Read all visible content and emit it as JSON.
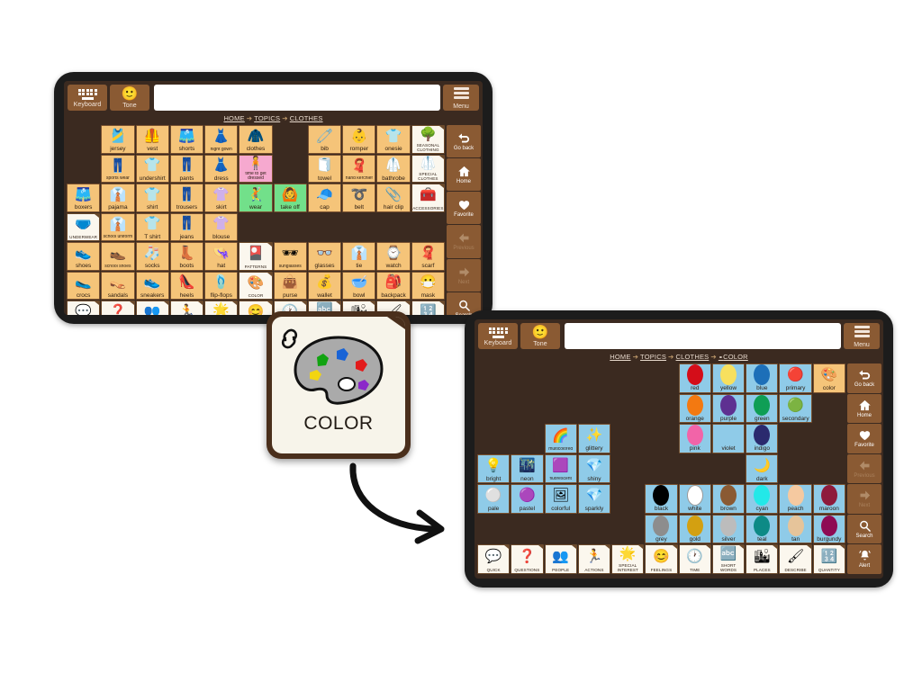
{
  "app": {
    "topbar": {
      "keyboard_label": "Keyboard",
      "tone_label": "Tone",
      "menu_label": "Menu",
      "message_value": "",
      "message_placeholder": ""
    },
    "rail": [
      {
        "name": "go-back",
        "label": "Go back",
        "icon": "go-back-icon",
        "dim": false
      },
      {
        "name": "home",
        "label": "Home",
        "icon": "home-icon",
        "dim": false
      },
      {
        "name": "favorite",
        "label": "Favorite",
        "icon": "heart-icon",
        "dim": false
      },
      {
        "name": "previous",
        "label": "Previous",
        "icon": "arrow-left-icon",
        "dim": true
      },
      {
        "name": "next",
        "label": "Next",
        "icon": "arrow-right-icon",
        "dim": true
      },
      {
        "name": "search",
        "label": "Search",
        "icon": "search-icon",
        "dim": false
      },
      {
        "name": "alert",
        "label": "Alert",
        "icon": "bell-icon",
        "dim": false
      }
    ],
    "colors": {
      "shell": "#1c1c1c",
      "screen_bg": "#3b2a20",
      "brown_button": "#8a5a33",
      "noun_tile": "#f5c479",
      "verb_tile": "#72e08a",
      "social_tile": "#f6a9cf",
      "color_tile": "#8fcbe8",
      "category_tile": "#fbf7ee",
      "grid_border": "#7a5230"
    }
  },
  "tablet1": {
    "breadcrumb": [
      "HOME",
      "TOPICS",
      "CLOTHES"
    ],
    "columns": 11,
    "rows": 8,
    "cells": [
      [
        {
          "label": "",
          "type": "empty"
        },
        {
          "label": "jersey",
          "type": "noun",
          "art": "jersey"
        },
        {
          "label": "vest",
          "type": "noun",
          "art": "vest"
        },
        {
          "label": "shorts",
          "type": "noun",
          "art": "shorts"
        },
        {
          "label": "night gown",
          "type": "noun",
          "art": "nightgown",
          "small": true
        },
        {
          "label": "clothes",
          "type": "noun",
          "art": "clothes"
        },
        {
          "label": "",
          "type": "empty"
        },
        {
          "label": "bib",
          "type": "noun",
          "art": "bib"
        },
        {
          "label": "romper",
          "type": "noun",
          "art": "romper"
        },
        {
          "label": "onesie",
          "type": "noun",
          "art": "onesie"
        },
        {
          "label": "SEASONAL CLOTHING",
          "type": "folder",
          "art": "seasonal"
        }
      ],
      [
        {
          "label": "",
          "type": "empty"
        },
        {
          "label": "sports wear",
          "type": "noun",
          "art": "sportswear",
          "small": true
        },
        {
          "label": "undershirt",
          "type": "noun",
          "art": "undershirt"
        },
        {
          "label": "pants",
          "type": "noun",
          "art": "pants"
        },
        {
          "label": "dress",
          "type": "noun",
          "art": "dress"
        },
        {
          "label": "time to get dressed",
          "type": "social",
          "art": "getdressed",
          "small": true
        },
        {
          "label": "",
          "type": "empty"
        },
        {
          "label": "towel",
          "type": "noun",
          "art": "towel"
        },
        {
          "label": "hand kerchief",
          "type": "noun",
          "art": "hanky",
          "small": true
        },
        {
          "label": "bathrobe",
          "type": "noun",
          "art": "bathrobe"
        },
        {
          "label": "SPECIAL CLOTHES",
          "type": "folder",
          "art": "specialclothes"
        }
      ],
      [
        {
          "label": "boxers",
          "type": "noun",
          "art": "boxers"
        },
        {
          "label": "pajama",
          "type": "noun",
          "art": "pajama"
        },
        {
          "label": "shirt",
          "type": "noun",
          "art": "shirt"
        },
        {
          "label": "trousers",
          "type": "noun",
          "art": "trousers"
        },
        {
          "label": "skirt",
          "type": "noun",
          "art": "skirt"
        },
        {
          "label": "wear",
          "type": "verb",
          "art": "wear"
        },
        {
          "label": "take off",
          "type": "verb",
          "art": "takeoff"
        },
        {
          "label": "cap",
          "type": "noun",
          "art": "cap"
        },
        {
          "label": "belt",
          "type": "noun",
          "art": "belt"
        },
        {
          "label": "hair clip",
          "type": "noun",
          "art": "hairclip"
        },
        {
          "label": "ACCESSORIES",
          "type": "folder",
          "art": "accessories"
        }
      ],
      [
        {
          "label": "UNDERWEAR",
          "type": "folder",
          "art": "underwear"
        },
        {
          "label": "school uniform",
          "type": "noun",
          "art": "uniform",
          "small": true
        },
        {
          "label": "T shirt",
          "type": "noun",
          "art": "tshirt"
        },
        {
          "label": "jeans",
          "type": "noun",
          "art": "jeans"
        },
        {
          "label": "blouse",
          "type": "noun",
          "art": "blouse"
        },
        {
          "label": "",
          "type": "empty"
        },
        {
          "label": "",
          "type": "empty"
        },
        {
          "label": "",
          "type": "empty"
        },
        {
          "label": "",
          "type": "empty"
        },
        {
          "label": "",
          "type": "empty"
        },
        {
          "label": "",
          "type": "empty"
        }
      ],
      [
        {
          "label": "shoes",
          "type": "noun",
          "art": "shoes"
        },
        {
          "label": "school shoes",
          "type": "noun",
          "art": "schoolshoes",
          "small": true
        },
        {
          "label": "socks",
          "type": "noun",
          "art": "socks"
        },
        {
          "label": "boots",
          "type": "noun",
          "art": "boots"
        },
        {
          "label": "hat",
          "type": "noun",
          "art": "hat"
        },
        {
          "label": "PATTERNS",
          "type": "folder",
          "art": "patterns"
        },
        {
          "label": "sunglasses",
          "type": "noun",
          "art": "sunglasses",
          "small": true
        },
        {
          "label": "glasses",
          "type": "noun",
          "art": "glasses"
        },
        {
          "label": "tie",
          "type": "noun",
          "art": "tie"
        },
        {
          "label": "watch",
          "type": "noun",
          "art": "watch"
        },
        {
          "label": "scarf",
          "type": "noun",
          "art": "scarf"
        }
      ],
      [
        {
          "label": "crocs",
          "type": "noun",
          "art": "crocs"
        },
        {
          "label": "sandals",
          "type": "noun",
          "art": "sandals"
        },
        {
          "label": "sneakers",
          "type": "noun",
          "art": "sneakers"
        },
        {
          "label": "heels",
          "type": "noun",
          "art": "heels"
        },
        {
          "label": "flip-flops",
          "type": "noun",
          "art": "flipflops"
        },
        {
          "label": "COLOR",
          "type": "folder",
          "art": "palette"
        },
        {
          "label": "purse",
          "type": "noun",
          "art": "purse"
        },
        {
          "label": "wallet",
          "type": "noun",
          "art": "wallet"
        },
        {
          "label": "bowl",
          "type": "noun",
          "art": "bowl"
        },
        {
          "label": "backpack",
          "type": "noun",
          "art": "backpack"
        },
        {
          "label": "mask",
          "type": "noun",
          "art": "mask"
        }
      ],
      [
        {
          "label": "QUICK",
          "type": "folder",
          "art": "quick"
        },
        {
          "label": "QUESTIONS",
          "type": "folder",
          "art": "questions"
        },
        {
          "label": "PEOPLE",
          "type": "folder",
          "art": "people"
        },
        {
          "label": "ACTIONS",
          "type": "folder",
          "art": "actions"
        },
        {
          "label": "SPECIAL INTEREST",
          "type": "folder",
          "art": "special"
        },
        {
          "label": "FEELINGS",
          "type": "folder",
          "art": "feelings"
        },
        {
          "label": "TIME",
          "type": "folder",
          "art": "time"
        },
        {
          "label": "SHORT WORDS",
          "type": "folder",
          "art": "shortwords"
        },
        {
          "label": "PLACES",
          "type": "folder",
          "art": "places"
        },
        {
          "label": "DESCRIBE",
          "type": "folder",
          "art": "describe"
        },
        {
          "label": "QUANTITY",
          "type": "folder",
          "art": "quantity"
        }
      ]
    ]
  },
  "tablet2": {
    "breadcrumb": [
      "HOME",
      "TOPICS",
      "CLOTHES",
      "COLOR"
    ],
    "breadcrumb_last_has_link_icon": true,
    "columns": 11,
    "rows": 7,
    "cells": [
      [
        {
          "label": "",
          "type": "empty"
        },
        {
          "label": "",
          "type": "empty"
        },
        {
          "label": "",
          "type": "empty"
        },
        {
          "label": "",
          "type": "empty"
        },
        {
          "label": "",
          "type": "empty"
        },
        {
          "label": "",
          "type": "empty"
        },
        {
          "label": "red",
          "type": "color",
          "swatch": "#d40d19"
        },
        {
          "label": "yellow",
          "type": "color",
          "swatch": "#f7e05e"
        },
        {
          "label": "blue",
          "type": "color",
          "swatch": "#1d6fb8"
        },
        {
          "label": "primary",
          "type": "colorfolder",
          "art": "primary"
        },
        {
          "label": "color",
          "type": "noun",
          "art": "palette"
        }
      ],
      [
        {
          "label": "",
          "type": "empty"
        },
        {
          "label": "",
          "type": "empty"
        },
        {
          "label": "",
          "type": "empty"
        },
        {
          "label": "",
          "type": "empty"
        },
        {
          "label": "",
          "type": "empty"
        },
        {
          "label": "",
          "type": "empty"
        },
        {
          "label": "orange",
          "type": "color",
          "swatch": "#f37911"
        },
        {
          "label": "purple",
          "type": "color",
          "swatch": "#5e3091"
        },
        {
          "label": "green",
          "type": "color",
          "swatch": "#0f9e55"
        },
        {
          "label": "secondary",
          "type": "colorfolder",
          "art": "secondary"
        },
        {
          "label": "",
          "type": "empty"
        }
      ],
      [
        {
          "label": "",
          "type": "empty"
        },
        {
          "label": "",
          "type": "empty"
        },
        {
          "label": "multicolored",
          "type": "color",
          "art": "multicolored",
          "small": true
        },
        {
          "label": "glittery",
          "type": "color",
          "art": "glittery"
        },
        {
          "label": "",
          "type": "empty"
        },
        {
          "label": "",
          "type": "empty"
        },
        {
          "label": "pink",
          "type": "color",
          "swatch": "#f264a8"
        },
        {
          "label": "violet",
          "type": "color",
          "swatch": "#a martin"
        },
        {
          "label": "indigo",
          "type": "color",
          "swatch": "#2b2a6e"
        },
        {
          "label": "",
          "type": "empty"
        },
        {
          "label": "",
          "type": "empty"
        }
      ],
      [
        {
          "label": "bright",
          "type": "color",
          "art": "bright"
        },
        {
          "label": "neon",
          "type": "color",
          "art": "neon"
        },
        {
          "label": "fluorescent",
          "type": "color",
          "art": "fluorescent",
          "small": true
        },
        {
          "label": "shiny",
          "type": "color",
          "art": "shiny"
        },
        {
          "label": "",
          "type": "empty"
        },
        {
          "label": "",
          "type": "empty"
        },
        {
          "label": "",
          "type": "empty"
        },
        {
          "label": "",
          "type": "empty"
        },
        {
          "label": "dark",
          "type": "color",
          "art": "dark"
        },
        {
          "label": "",
          "type": "empty"
        },
        {
          "label": "",
          "type": "empty"
        }
      ],
      [
        {
          "label": "pale",
          "type": "color",
          "art": "pale"
        },
        {
          "label": "pastel",
          "type": "color",
          "art": "pastel"
        },
        {
          "label": "colorful",
          "type": "color",
          "art": "colorful"
        },
        {
          "label": "sparkly",
          "type": "color",
          "art": "sparkly"
        },
        {
          "label": "",
          "type": "empty"
        },
        {
          "label": "black",
          "type": "color",
          "swatch": "#000000"
        },
        {
          "label": "white",
          "type": "color",
          "swatch": "#ffffff"
        },
        {
          "label": "brown",
          "type": "color",
          "swatch": "#8a5a33"
        },
        {
          "label": "cyan",
          "type": "color",
          "swatch": "#23e8e8"
        },
        {
          "label": "peach",
          "type": "color",
          "swatch": "#f5c9a0"
        },
        {
          "label": "maroon",
          "type": "color",
          "swatch": "#8e1b3c"
        }
      ],
      [
        {
          "label": "",
          "type": "empty"
        },
        {
          "label": "",
          "type": "empty"
        },
        {
          "label": "",
          "type": "empty"
        },
        {
          "label": "",
          "type": "empty"
        },
        {
          "label": "",
          "type": "empty"
        },
        {
          "label": "grey",
          "type": "color",
          "swatch": "#8d8d8d"
        },
        {
          "label": "gold",
          "type": "color",
          "swatch": "#d3a011"
        },
        {
          "label": "silver",
          "type": "color",
          "swatch": "#bcbcbc"
        },
        {
          "label": "teal",
          "type": "color",
          "swatch": "#0d8a86"
        },
        {
          "label": "tan",
          "type": "color",
          "swatch": "#e6c49a"
        },
        {
          "label": "burgundy",
          "type": "color",
          "swatch": "#8e0b54"
        }
      ],
      [
        {
          "label": "QUICK",
          "type": "folder",
          "art": "quick"
        },
        {
          "label": "QUESTIONS",
          "type": "folder",
          "art": "questions"
        },
        {
          "label": "PEOPLE",
          "type": "folder",
          "art": "people"
        },
        {
          "label": "ACTIONS",
          "type": "folder",
          "art": "actions"
        },
        {
          "label": "SPECIAL INTEREST",
          "type": "folder",
          "art": "special"
        },
        {
          "label": "FEELINGS",
          "type": "folder",
          "art": "feelings"
        },
        {
          "label": "TIME",
          "type": "folder",
          "art": "time"
        },
        {
          "label": "SHORT WORDS",
          "type": "folder",
          "art": "shortwords"
        },
        {
          "label": "PLACES",
          "type": "folder",
          "art": "places"
        },
        {
          "label": "DESCRIBE",
          "type": "folder",
          "art": "describe"
        },
        {
          "label": "QUANTITY",
          "type": "folder",
          "art": "quantity"
        }
      ]
    ]
  },
  "popup": {
    "title": "COLOR",
    "icon": "palette-icon",
    "link_icon": "link-icon"
  },
  "flow": {
    "arrow_icon": "curved-arrow-icon"
  }
}
